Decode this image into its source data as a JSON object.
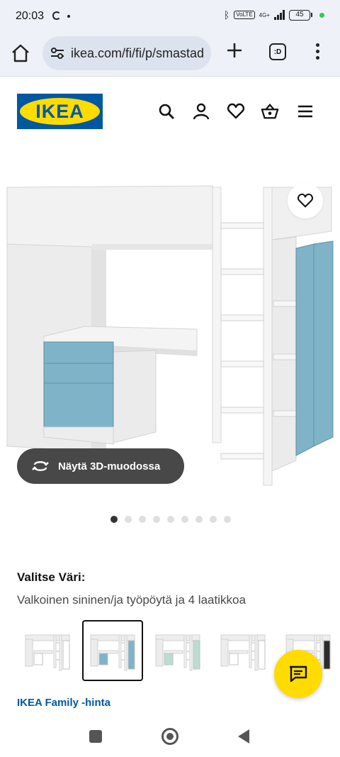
{
  "status_bar": {
    "time": "20:03",
    "network": "4G+",
    "volte": "VoLTE",
    "battery": "45"
  },
  "browser": {
    "url": "ikea.com/fi/fi/p/smastad",
    "tabs_label": ":D"
  },
  "header": {
    "logo_text": "IKEA",
    "brand_blue": "#0058a3",
    "brand_yellow": "#ffdb00"
  },
  "product": {
    "view_3d_label": "Näytä 3D-muodossa",
    "carousel": {
      "total": 9,
      "active_index": 0
    },
    "color_label": "Valitse Väri:",
    "color_value": "Valkoinen sininen/ja työpöytä ja 4 laatikkoa",
    "variants": [
      {
        "accent": "#ffffff",
        "selected": false
      },
      {
        "accent": "#7fb3c8",
        "selected": true
      },
      {
        "accent": "#b9ddd2",
        "selected": false
      },
      {
        "accent": "#ffffff",
        "selected": false
      },
      {
        "accent": "#2b2b2b",
        "selected": false
      }
    ],
    "family_price_label": "IKEA Family -hinta"
  }
}
